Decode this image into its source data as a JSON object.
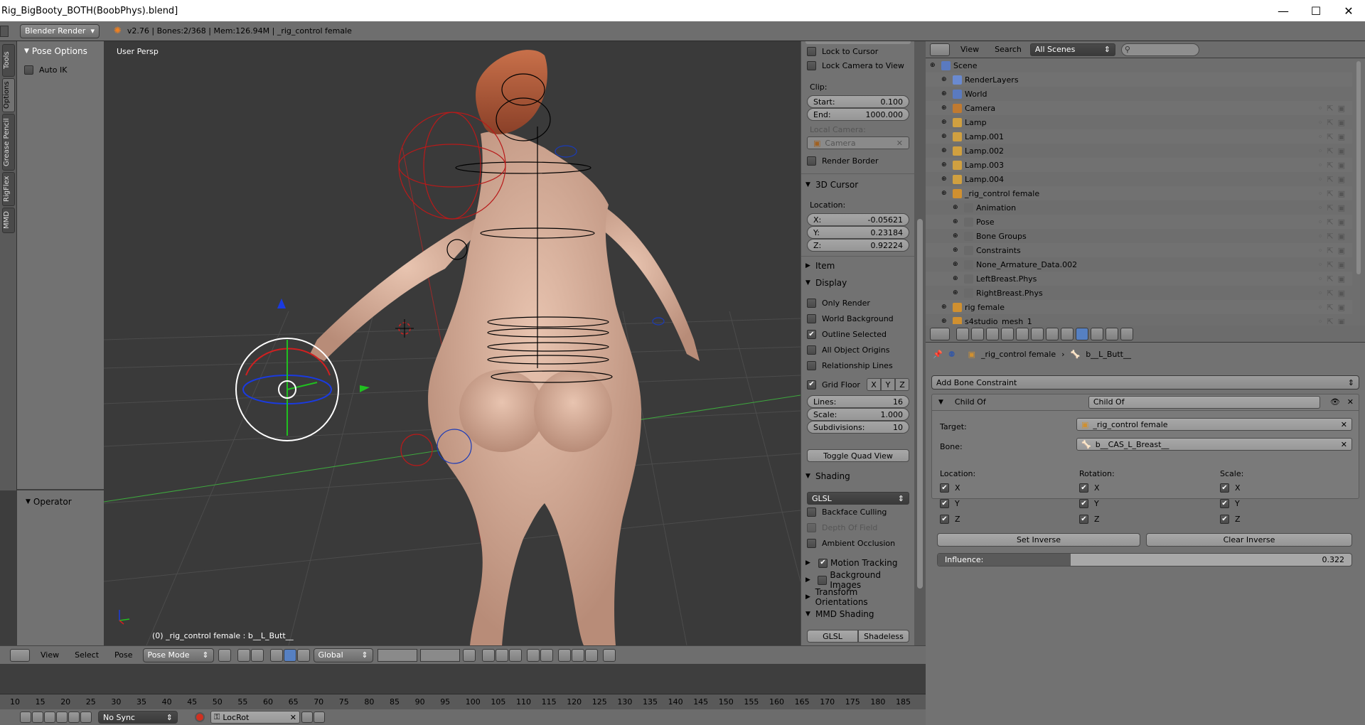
{
  "window": {
    "title": "Rig_BigBooty_BOTH(BoobPhys).blend]",
    "min_icon": "minimize-icon",
    "max_icon": "maximize-icon",
    "close_icon": "close-icon"
  },
  "topbar": {
    "render_engine": "Blender Render",
    "stats": "v2.76 | Bones:2/368 | Mem:126.94M | _rig_control female"
  },
  "side_tabs": [
    "Tools",
    "Options",
    "Grease Pencil",
    "RigFlex",
    "MMD"
  ],
  "tool_panel": {
    "pose_options_title": "Pose Options",
    "auto_ik_label": "Auto IK",
    "auto_ik": false,
    "operator_title": "Operator"
  },
  "viewport": {
    "view_label": "User Persp",
    "status": "(0) _rig_control female : b__L_Butt__"
  },
  "npanel": {
    "lock_to_cursor": "Lock to Cursor",
    "lock_camera": "Lock Camera to View",
    "clip_label": "Clip:",
    "clip_start_label": "Start:",
    "clip_start": "0.100",
    "clip_end_label": "End:",
    "clip_end": "1000.000",
    "local_camera_label": "Local Camera:",
    "local_camera_value": "Camera",
    "render_border": "Render Border",
    "cursor_title": "3D Cursor",
    "location_label": "Location:",
    "x_label": "X:",
    "x_value": "-0.05621",
    "y_label": "Y:",
    "y_value": "0.23184",
    "z_label": "Z:",
    "z_value": "0.92224",
    "item_title": "Item",
    "display_title": "Display",
    "only_render": "Only Render",
    "world_background": "World Background",
    "outline_selected": "Outline Selected",
    "all_object_origins": "All Object Origins",
    "relationship_lines": "Relationship Lines",
    "grid_floor": "Grid Floor",
    "axis_x": "X",
    "axis_y": "Y",
    "axis_z": "Z",
    "lines_label": "Lines:",
    "lines_value": "16",
    "scale_label": "Scale:",
    "scale_value": "1.000",
    "subdiv_label": "Subdivisions:",
    "subdiv_value": "10",
    "toggle_quad": "Toggle Quad View",
    "shading_title": "Shading",
    "shading_mode": "GLSL",
    "backface_culling": "Backface Culling",
    "depth_of_field": "Depth Of Field",
    "ambient_occlusion": "Ambient Occlusion",
    "motion_tracking": "Motion Tracking",
    "background_images": "Background Images",
    "transform_orientations": "Transform Orientations",
    "mmd_shading": "MMD Shading",
    "glsl_btn": "GLSL",
    "shadeless_btn": "Shadeless"
  },
  "outliner": {
    "view": "View",
    "search": "Search",
    "scenes": "All Scenes",
    "rows": [
      {
        "label": "Scene",
        "indent": 0
      },
      {
        "label": "RenderLayers",
        "indent": 1
      },
      {
        "label": "World",
        "indent": 1
      },
      {
        "label": "Camera",
        "indent": 1
      },
      {
        "label": "Lamp",
        "indent": 1
      },
      {
        "label": "Lamp.001",
        "indent": 1
      },
      {
        "label": "Lamp.002",
        "indent": 1
      },
      {
        "label": "Lamp.003",
        "indent": 1
      },
      {
        "label": "Lamp.004",
        "indent": 1
      },
      {
        "label": "_rig_control female",
        "indent": 1
      },
      {
        "label": "Animation",
        "indent": 2
      },
      {
        "label": "Pose",
        "indent": 2
      },
      {
        "label": "Bone Groups",
        "indent": 2
      },
      {
        "label": "Constraints",
        "indent": 2
      },
      {
        "label": "None_Armature_Data.002",
        "indent": 2
      },
      {
        "label": "LeftBreast.Phys",
        "indent": 2
      },
      {
        "label": "RightBreast.Phys",
        "indent": 2
      },
      {
        "label": "rig female",
        "indent": 1
      },
      {
        "label": "s4studio_mesh_1",
        "indent": 1
      }
    ]
  },
  "properties": {
    "breadcrumb_object": "_rig_control female",
    "breadcrumb_bone": "b__L_Butt__",
    "add_constraint": "Add Bone Constraint",
    "constraint_type": "Child Of",
    "constraint_name": "Child Of",
    "target_label": "Target:",
    "target_value": "_rig_control female",
    "bone_label": "Bone:",
    "bone_value": "b__CAS_L_Breast__",
    "location_label": "Location:",
    "rotation_label": "Rotation:",
    "scale_label": "Scale:",
    "x": "X",
    "y": "Y",
    "z": "Z",
    "set_inverse": "Set Inverse",
    "clear_inverse": "Clear Inverse",
    "influence_label": "Influence:",
    "influence": 0.322,
    "influence_text": "0.322"
  },
  "view3d_header": {
    "view": "View",
    "select": "Select",
    "pose": "Pose",
    "mode": "Pose Mode",
    "orientation": "Global"
  },
  "timeline": {
    "ticks": [
      "10",
      "15",
      "20",
      "25",
      "30",
      "35",
      "40",
      "45",
      "50",
      "55",
      "60",
      "65",
      "70",
      "75",
      "80",
      "85",
      "90",
      "95",
      "100",
      "105",
      "110",
      "115",
      "120",
      "125",
      "130",
      "135",
      "140",
      "145",
      "150",
      "155",
      "160",
      "165",
      "170",
      "175",
      "180",
      "185"
    ],
    "sync": "No Sync",
    "keying_set": "LocRot"
  }
}
